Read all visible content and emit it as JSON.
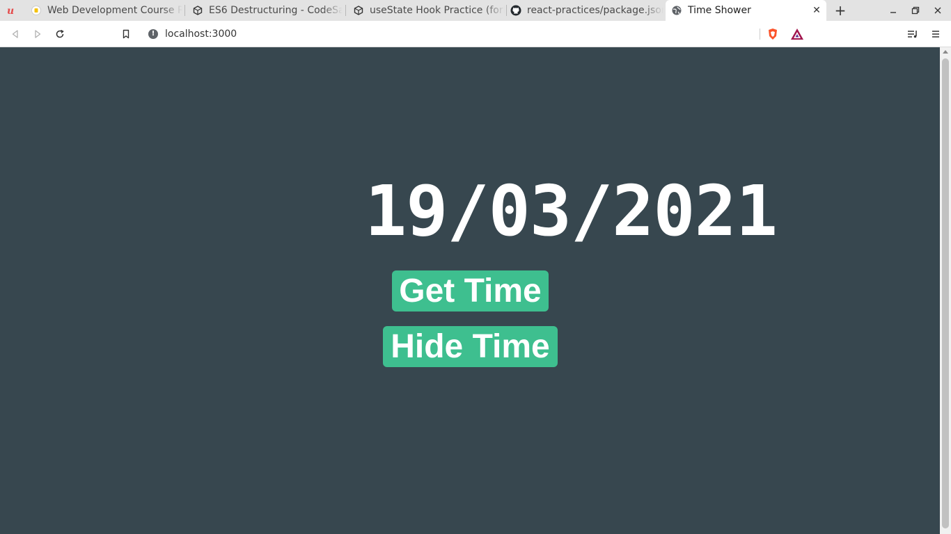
{
  "browser": {
    "tabs": [
      {
        "title": "Web Development Course Re",
        "icon": "udemy-icon"
      },
      {
        "title": "ES6 Destructuring - CodeSan",
        "icon": "codesandbox-icon"
      },
      {
        "title": "useState Hook Practice (fork",
        "icon": "codesandbox-icon"
      },
      {
        "title": "react-practices/package.json",
        "icon": "github-icon"
      },
      {
        "title": "Time Shower",
        "icon": "globe-icon",
        "active": true
      }
    ],
    "address": "localhost:3000"
  },
  "app": {
    "time_text": "19/03/2021",
    "get_time_label": "Get Time",
    "hide_time_label": "Hide Time"
  },
  "colors": {
    "page_background": "#37474f",
    "button_background": "#3ebf8f",
    "text": "#ffffff"
  }
}
